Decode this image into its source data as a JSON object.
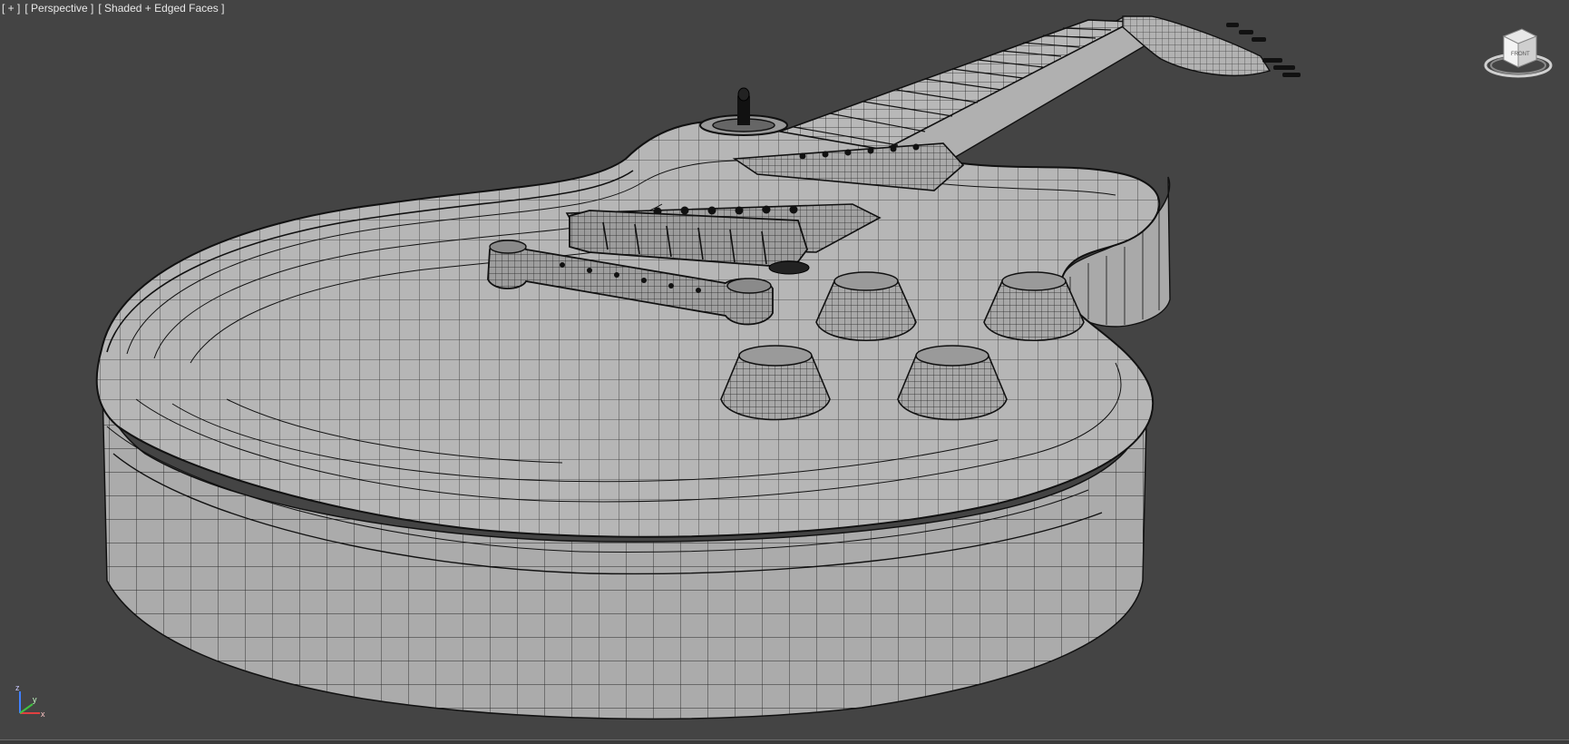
{
  "viewport": {
    "menu_label": "[ + ]",
    "view_label": "[ Perspective ]",
    "shading_label": "[ Shaded + Edged Faces ]",
    "background_color": "#444444",
    "mesh_fill_color": "#b4b4b4",
    "wire_color": "#111111"
  },
  "viewcube": {
    "face_label": "FRONT"
  },
  "axis_tripod": {
    "x_label": "x",
    "y_label": "y",
    "z_label": "z",
    "x_color": "#e04040",
    "y_color": "#40c040",
    "z_color": "#4080ff"
  },
  "scene": {
    "object": "electric-guitar-mesh",
    "knob_count": 4,
    "pickup_count": 2
  }
}
